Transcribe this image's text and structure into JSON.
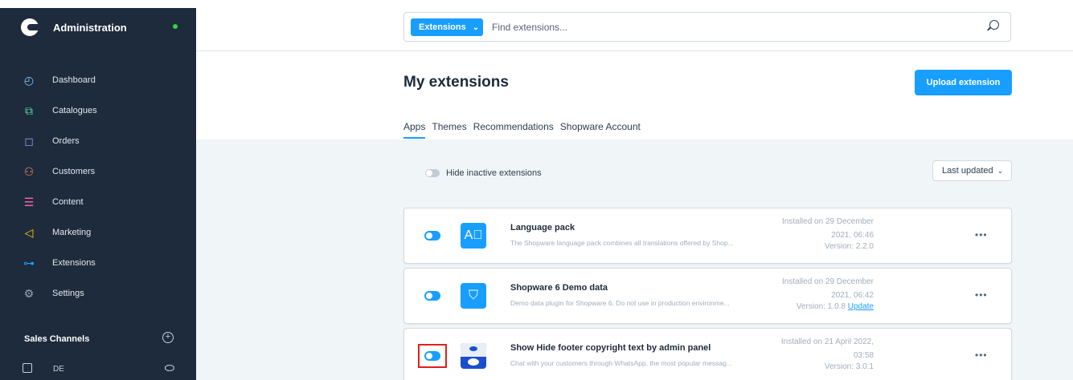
{
  "sidebar": {
    "title": "Administration",
    "items": [
      {
        "label": "Dashboard",
        "icon": "dashboard-icon",
        "color": "#7cc7ff"
      },
      {
        "label": "Catalogues",
        "icon": "catalogues-icon",
        "color": "#57d9a3"
      },
      {
        "label": "Orders",
        "icon": "orders-icon",
        "color": "#a092f0"
      },
      {
        "label": "Customers",
        "icon": "customers-icon",
        "color": "#f88962"
      },
      {
        "label": "Content",
        "icon": "content-icon",
        "color": "#ff68b4"
      },
      {
        "label": "Marketing",
        "icon": "marketing-icon",
        "color": "#ffd700"
      },
      {
        "label": "Extensions",
        "icon": "extensions-icon",
        "color": "#189eff"
      },
      {
        "label": "Settings",
        "icon": "settings-icon",
        "color": "#9aa8b5"
      }
    ],
    "sales_channels_title": "Sales Channels",
    "sales_channels": [
      {
        "label": "DE"
      }
    ]
  },
  "search": {
    "type_label": "Extensions",
    "placeholder": "Find extensions..."
  },
  "page": {
    "title": "My extensions",
    "upload_label": "Upload extension",
    "tabs": [
      {
        "label": "Apps",
        "active": true
      },
      {
        "label": "Themes",
        "active": false
      },
      {
        "label": "Recommendations",
        "active": false
      },
      {
        "label": "Shopware Account",
        "active": false
      }
    ],
    "hide_inactive_label": "Hide inactive extensions",
    "sort_label": "Last updated"
  },
  "extensions": [
    {
      "name": "Language pack",
      "description": "The Shopware language pack combines all translations offered by Shop...",
      "installed_line1": "Installed on 29 December",
      "installed_line2": "2021, 06:46",
      "version": "Version: 2.2.0",
      "update_label": "",
      "active": true
    },
    {
      "name": "Shopware 6 Demo data",
      "description": "Demo data plugin for Shopware 6. Do not use in production environme...",
      "installed_line1": "Installed on 29 December",
      "installed_line2": "2021, 06:42",
      "version": "Version: 1.0.8",
      "update_label": "Update",
      "active": true
    },
    {
      "name": "Show Hide footer copyright text by admin panel",
      "description": "Chat with your customers through WhatsApp, the most popular messag...",
      "installed_line1": "Installed on 21 April 2022,",
      "installed_line2": "03:58",
      "version": "Version: 3.0.1",
      "update_label": "",
      "active": true
    }
  ],
  "colors": {
    "accent": "#189eff",
    "sidebar_bg": "#1e2b3c",
    "content_bg": "#f0f6f7",
    "highlight": "#e0201b",
    "status_online": "#37d046"
  }
}
